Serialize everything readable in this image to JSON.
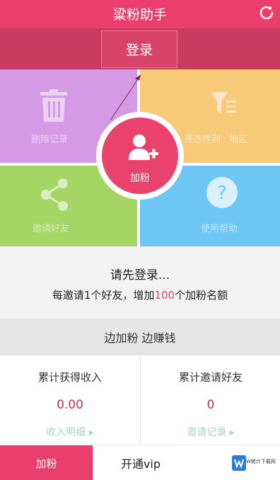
{
  "header": {
    "title": "粱粉助手",
    "refresh_icon": "refresh-icon"
  },
  "login": {
    "button_label": "登录"
  },
  "tiles": [
    {
      "label": "删除记录",
      "icon": "trash-icon",
      "color": "#d49ae6"
    },
    {
      "label": "筛选性别 · 地区",
      "icon": "funnel-icon",
      "color": "#f9c97a"
    },
    {
      "label": "邀请好友",
      "icon": "share-icon",
      "color": "#a5d665"
    },
    {
      "label": "使用帮助",
      "icon": "help-icon",
      "color": "#6dc7f2"
    }
  ],
  "center_button": {
    "label": "加粉",
    "icon": "add-user-icon"
  },
  "message": {
    "line1": "请先登录...",
    "line2_prefix": "每邀请1个好友，增加",
    "line2_highlight": "100",
    "line2_suffix": "个加粉名额"
  },
  "slogan": "边加粉 边赚钱",
  "stats": {
    "income": {
      "label": "累计获得收入",
      "value": "0.00",
      "link": "收入明细 ▸"
    },
    "invites": {
      "label": "累计邀请好友",
      "value": "0",
      "link": "邀请记录 ▸"
    }
  },
  "tabs": [
    {
      "label": "加粉",
      "active": true
    },
    {
      "label": "开通vip",
      "active": false
    }
  ],
  "watermark": {
    "text": "W统计下载网"
  },
  "colors": {
    "primary": "#ea3f6c",
    "dark_primary": "#ca3b62",
    "value": "#c0325a"
  }
}
